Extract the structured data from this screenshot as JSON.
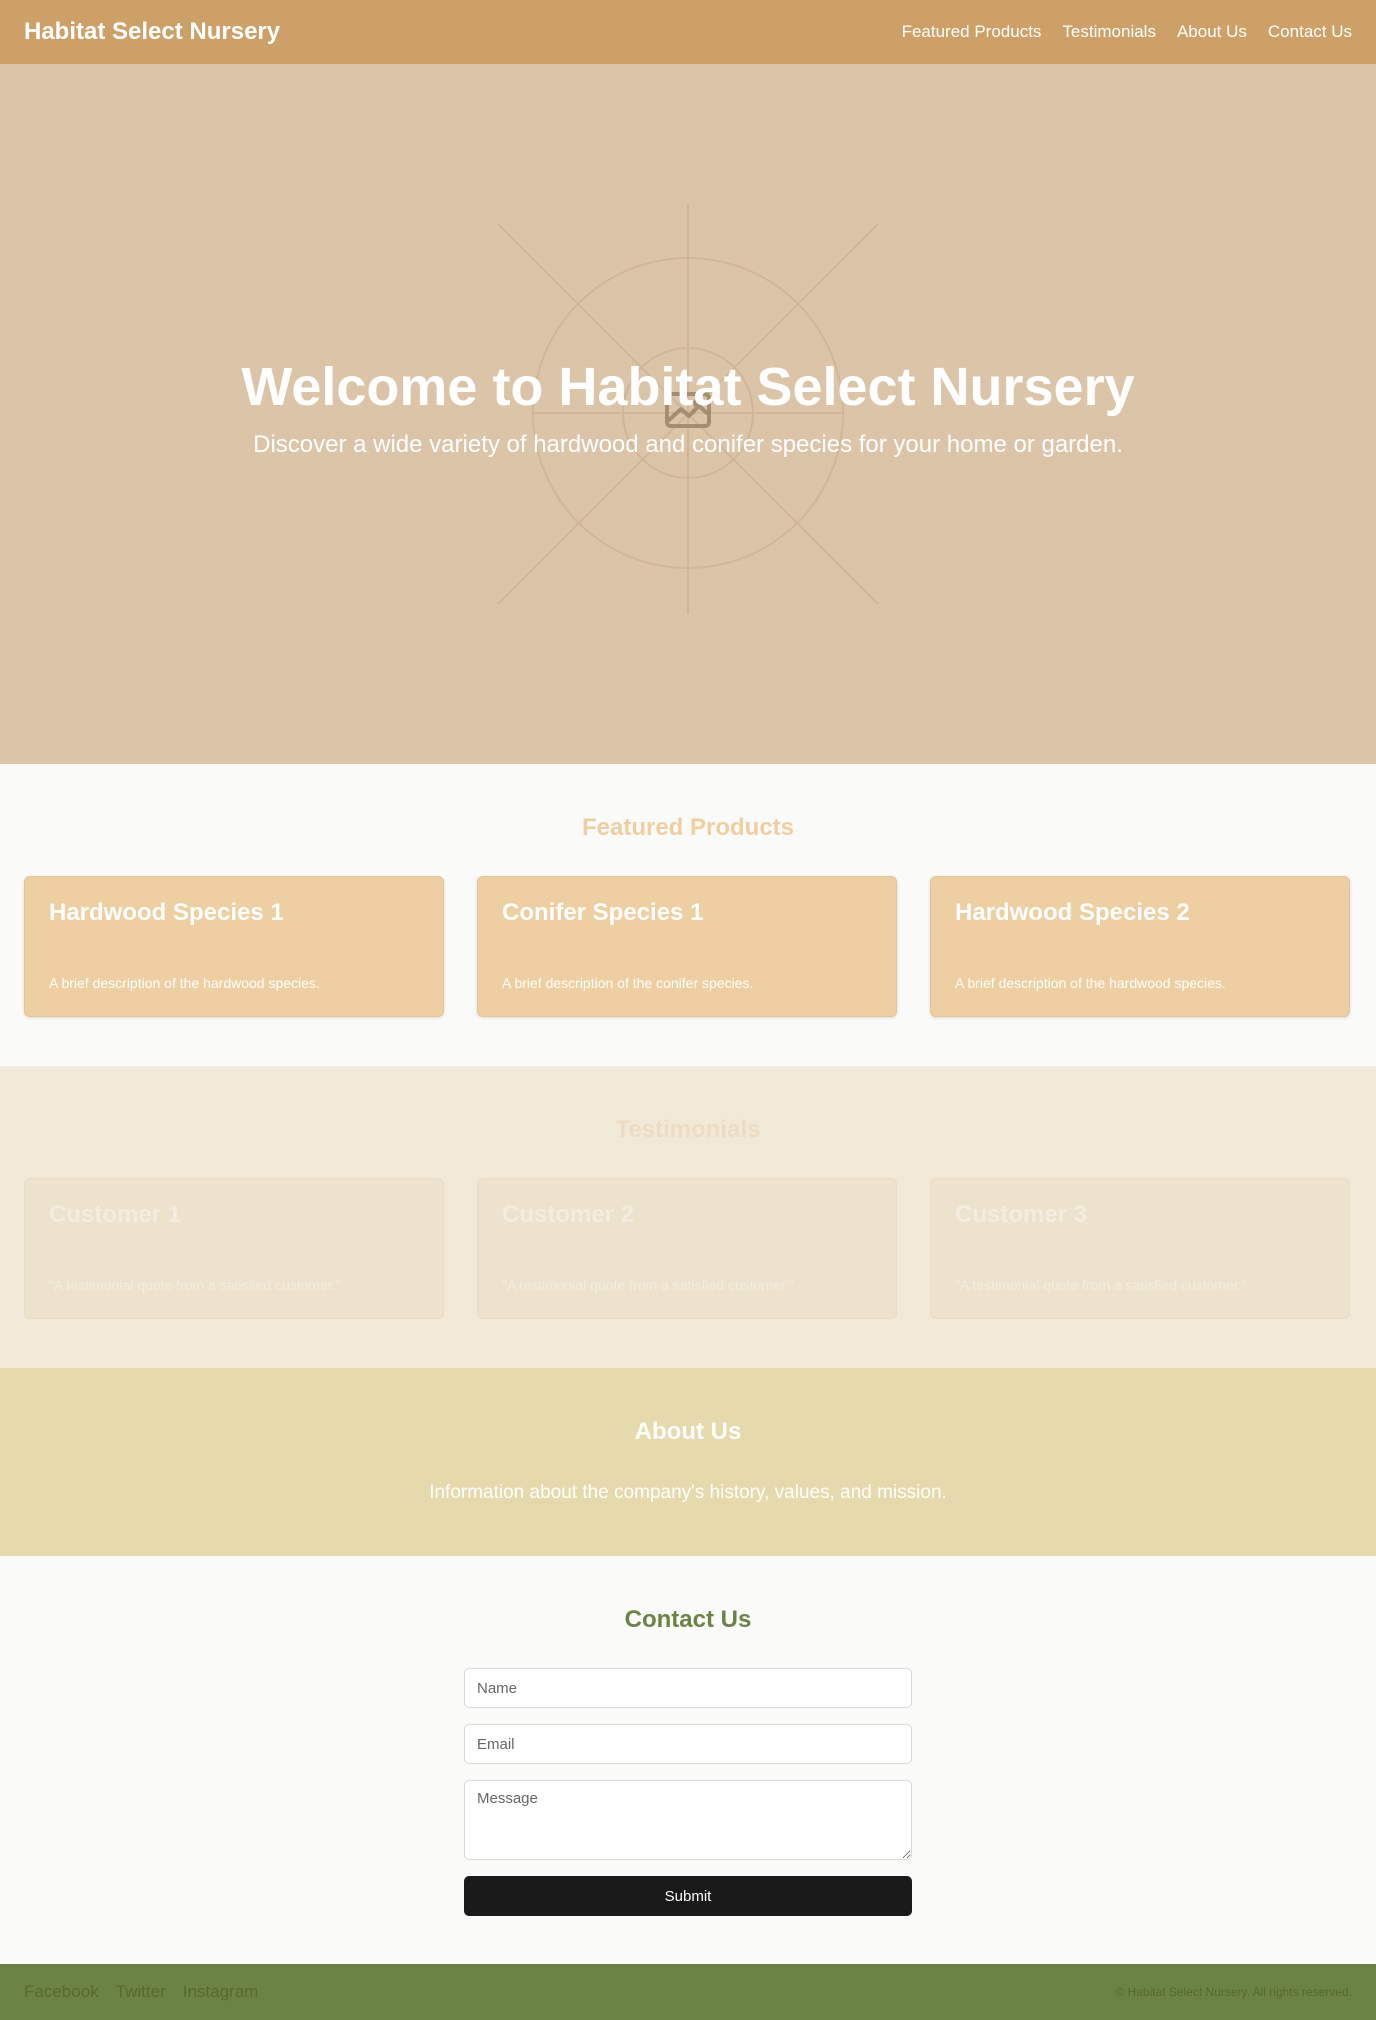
{
  "header": {
    "brand": "Habitat Select Nursery",
    "nav": [
      "Featured Products",
      "Testimonials",
      "About Us",
      "Contact Us"
    ]
  },
  "hero": {
    "title": "Welcome to Habitat Select Nursery",
    "subtitle": "Discover a wide variety of hardwood and conifer species for your home or garden.",
    "image_icon": "image-placeholder-icon"
  },
  "products": {
    "title": "Featured Products",
    "items": [
      {
        "name": "Hardwood Species 1",
        "description": "A brief description of the hardwood species."
      },
      {
        "name": "Conifer Species 1",
        "description": "A brief description of the conifer species."
      },
      {
        "name": "Hardwood Species 2",
        "description": "A brief description of the hardwood species."
      }
    ]
  },
  "testimonials": {
    "title": "Testimonials",
    "items": [
      {
        "name": "Customer 1",
        "quote": "\"A testimonial quote from a satisfied customer.\""
      },
      {
        "name": "Customer 2",
        "quote": "\"A testimonial quote from a satisfied customer.\""
      },
      {
        "name": "Customer 3",
        "quote": "\"A testimonial quote from a satisfied customer.\""
      }
    ]
  },
  "about": {
    "title": "About Us",
    "text": "Information about the company's history, values, and mission."
  },
  "contact": {
    "title": "Contact Us",
    "name_placeholder": "Name",
    "email_placeholder": "Email",
    "message_placeholder": "Message",
    "submit_label": "Submit"
  },
  "footer": {
    "social": [
      "Facebook",
      "Twitter",
      "Instagram"
    ],
    "copyright": "© Habitat Select Nursery. All rights reserved."
  },
  "colors": {
    "header": "#cca067",
    "hero": "#dbc4a8",
    "product_card": "#eecfa1",
    "about": "#e6d9ab",
    "footer": "#6b8345",
    "contact_title": "#6b8345",
    "submit": "#1a1a1b"
  }
}
